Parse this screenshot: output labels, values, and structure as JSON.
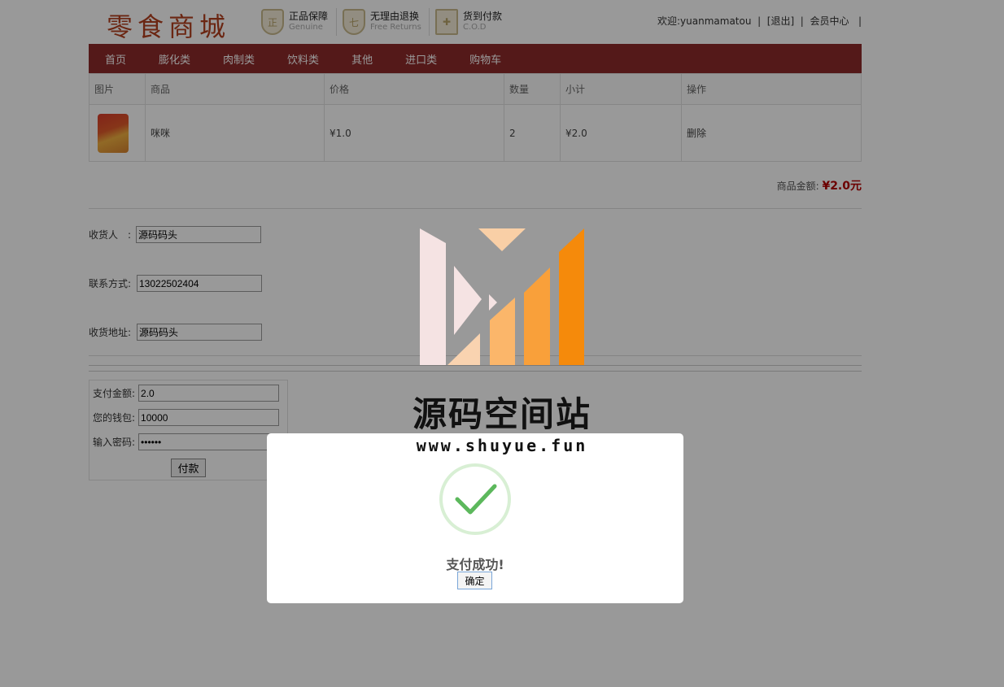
{
  "header": {
    "logo": "零食商城",
    "promises": [
      {
        "title": "正品保障",
        "sub": "Genuine",
        "icon": "正"
      },
      {
        "title": "无理由退换",
        "sub": "Free Returns",
        "icon": "七"
      },
      {
        "title": "货到付款",
        "sub": "C.O.D",
        "icon": "✚"
      }
    ],
    "welcome": "欢迎:yuanmamatou",
    "logout": "[退出]",
    "member": "会员中心",
    "sep": "|"
  },
  "nav": [
    "首页",
    "膨化类",
    "肉制类",
    "饮料类",
    "其他",
    "进口类",
    "购物车"
  ],
  "cart": {
    "columns": [
      "图片",
      "商品",
      "价格",
      "数量",
      "小计",
      "操作"
    ],
    "rows": [
      {
        "name": "咪咪",
        "price": "¥1.0",
        "qty": "2",
        "subtotal": "¥2.0",
        "action": "删除"
      }
    ],
    "total_label": "商品金额:",
    "total_value": "¥2.0元"
  },
  "form": {
    "receiver_label": "收货人　:",
    "receiver_value": "源码码头",
    "phone_label": "联系方式:",
    "phone_value": "13022502404",
    "address_label": "收货地址:",
    "address_value": "源码码头"
  },
  "pay": {
    "amount_label": "支付金额:",
    "amount_value": "2.0",
    "wallet_label": "您的钱包:",
    "wallet_value": "10000",
    "password_label": "输入密码:",
    "password_value": "••••••",
    "pay_button": "付款"
  },
  "watermark": {
    "title": "源码空间站",
    "url": "www.shuyue.fun"
  },
  "dialog": {
    "message": "支付成功!",
    "ok": "确定",
    "icon": "check-icon",
    "check_color": "#5cb85c"
  },
  "colors": {
    "nav_bg": "#8c2b2b",
    "price_red": "#b50000",
    "logo_orange": "#f58a0b"
  }
}
